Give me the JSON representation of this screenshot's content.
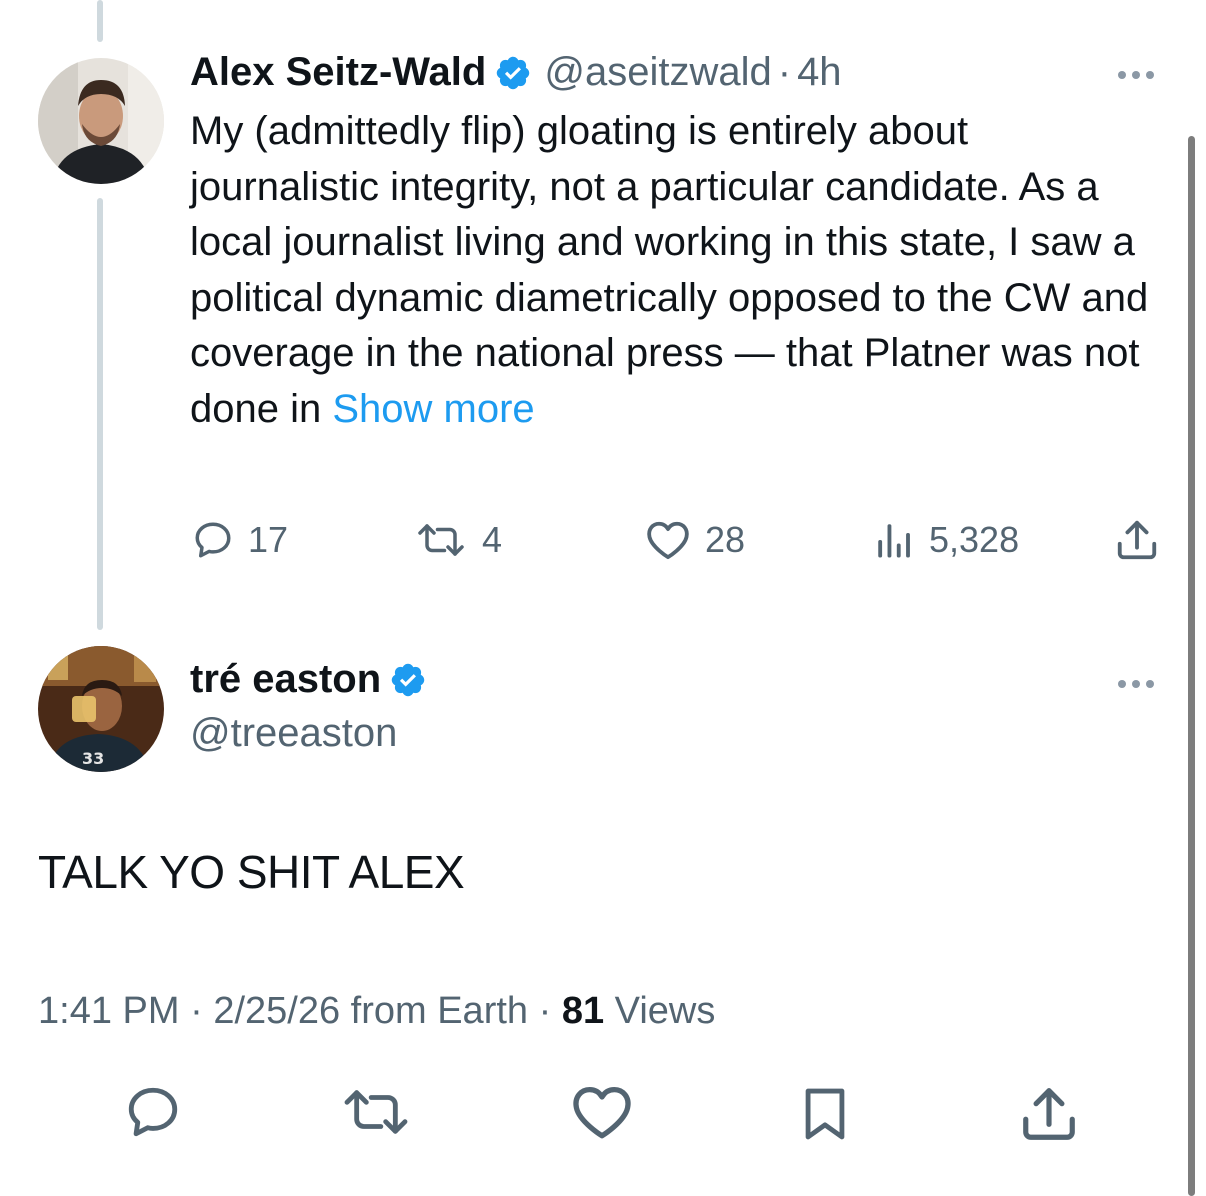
{
  "parent_tweet": {
    "display_name": "Alex Seitz-Wald",
    "handle": "@aseitzwald",
    "separator": "·",
    "time": "4h",
    "text": "My (admittedly flip) gloating is entirely about journalistic integrity, not a particular candidate. As a local journalist living and working in this state, I saw a political dynamic diametrically opposed to the CW and coverage in the national press — that Platner was not done in ",
    "show_more": "Show more",
    "actions": {
      "replies": "17",
      "reposts": "4",
      "likes": "28",
      "views": "5,328"
    }
  },
  "reply_tweet": {
    "display_name": "tré easton",
    "handle": "@treeaston",
    "text": "TALK YO SHIT ALEX",
    "meta": {
      "time": "1:41 PM",
      "sep1": "·",
      "date_source": "2/25/26 from Earth",
      "sep2": "·",
      "views_count": "81",
      "views_label": "Views"
    }
  },
  "colors": {
    "accent": "#1d9bf0",
    "text": "#0f1419",
    "muted": "#536471",
    "thread_line": "#cfd9de"
  },
  "icons": {
    "verified": "verified-badge-icon",
    "reply": "speech-bubble-icon",
    "repost": "repost-arrows-icon",
    "like": "heart-icon",
    "views": "bar-chart-icon",
    "share": "upload-share-icon",
    "bookmark": "bookmark-icon",
    "more": "ellipsis-icon"
  }
}
